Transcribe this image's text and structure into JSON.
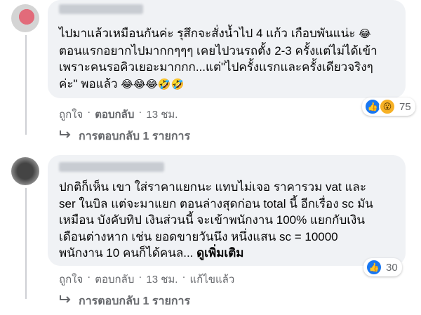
{
  "comments": [
    {
      "text": "ไปมาแล้วเหมือนกันค่ะ รุสึกจะสั่งน้ำไป 4 แก้ว เกือบพันแน่ะ ",
      "text_line2": "ตอนแรกอยากไปมากกๆๆๆ เคยไปวนรถตั้ง 2-3 ครั้งแต่ไม่ได้เข้า",
      "text_line3": "เพราะคนรอคิวเยอะมากกก...แต่\"ไปครั้งแรกและครั้งเดียวจริงๆ",
      "text_line4": "ค่ะ\" พอแล้ว ",
      "emoji_1": "😂",
      "emoji_2": "😂😂😂🤣🤣",
      "reaction_count": "75",
      "actions": {
        "like": "ถูกใจ",
        "reply": "ตอบกลับ",
        "time": "13 ชม."
      },
      "replies_label": "การตอบกลับ 1 รายการ"
    },
    {
      "text_line1": "ปกติก็เห็น เขา ใส่ราคาแยกนะ แทบไม่เจอ ราคารวม vat และ",
      "text_line2": "ser ในบิล แต่จะมาแยก ตอนล่างสุดก่อน total นี้ อีกเรื่อง sc มัน",
      "text_line3": "เหมือน บังคับทิป เงินส่วนนี้ จะเข้าพนักงาน 100% แยกกับเงิน",
      "text_line4": "เดือนต่างหาก เช่น ยอดขายวันนึง หนึ่งแสน sc = 10000",
      "text_line5": "พนักงาน 10 คนก็ได้คนล...",
      "see_more": "ดูเพิ่มเติม",
      "reaction_count": "30",
      "actions": {
        "like": "ถูกใจ",
        "reply": "ตอบกลับ",
        "time": "13 ชม.",
        "edited": "แก้ไขแล้ว"
      },
      "replies_label": "การตอบกลับ 1 รายการ"
    }
  ],
  "icons": {
    "like": "like-icon",
    "wow": "wow-icon",
    "reply_arrow": "reply-arrow-icon"
  },
  "colors": {
    "bubble": "#f0f2f5",
    "meta_text": "#65676b",
    "like_blue": "#1877f2"
  }
}
